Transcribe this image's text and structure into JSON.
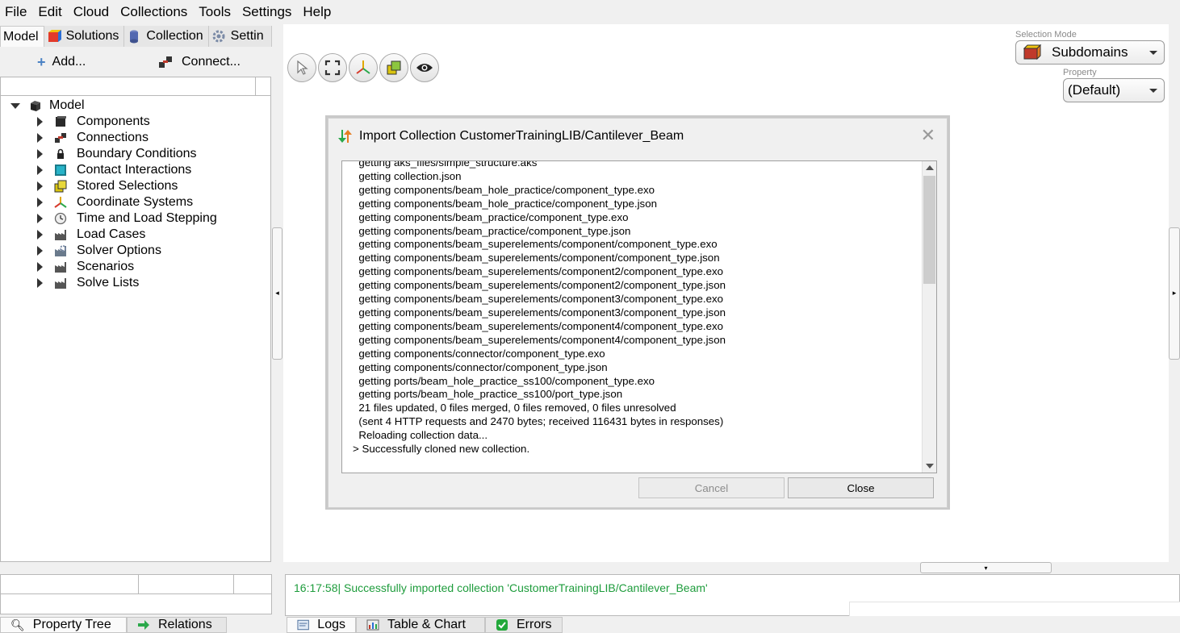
{
  "menu": [
    "File",
    "Edit",
    "Cloud",
    "Collections",
    "Tools",
    "Settings",
    "Help"
  ],
  "left_tabs": [
    "Model",
    "Solutions",
    "Collection",
    "Settings"
  ],
  "left_tabs_visible": [
    "Model",
    "Solutions",
    "Collection",
    "Settin"
  ],
  "toolbar": {
    "add_label": "Add...",
    "connect_label": "Connect..."
  },
  "tree": {
    "root": "Model",
    "children": [
      "Components",
      "Connections",
      "Boundary Conditions",
      "Contact Interactions",
      "Stored Selections",
      "Coordinate Systems",
      "Time and Load Stepping",
      "Load Cases",
      "Solver Options",
      "Scenarios",
      "Solve Lists"
    ]
  },
  "selection_mode": {
    "label": "Selection Mode",
    "value": "Subdomains"
  },
  "property": {
    "label": "Property",
    "value": "(Default)"
  },
  "dialog": {
    "title": "Import Collection CustomerTrainingLIB/Cantilever_Beam",
    "log_lines": [
      "  getting aks_files/simple_structure.aks",
      "  getting collection.json",
      "  getting components/beam_hole_practice/component_type.exo",
      "  getting components/beam_hole_practice/component_type.json",
      "  getting components/beam_practice/component_type.exo",
      "  getting components/beam_practice/component_type.json",
      "  getting components/beam_superelements/component/component_type.exo",
      "  getting components/beam_superelements/component/component_type.json",
      "  getting components/beam_superelements/component2/component_type.exo",
      "  getting components/beam_superelements/component2/component_type.json",
      "  getting components/beam_superelements/component3/component_type.exo",
      "  getting components/beam_superelements/component3/component_type.json",
      "  getting components/beam_superelements/component4/component_type.exo",
      "  getting components/beam_superelements/component4/component_type.json",
      "  getting components/connector/component_type.exo",
      "  getting components/connector/component_type.json",
      "  getting ports/beam_hole_practice_ss100/component_type.exo",
      "  getting ports/beam_hole_practice_ss100/port_type.json",
      "  21 files updated, 0 files merged, 0 files removed, 0 files unresolved",
      "  (sent 4 HTTP requests and 2470 bytes; received 116431 bytes in responses)",
      "  Reloading collection data...",
      "> Successfully cloned new collection."
    ],
    "cancel_label": "Cancel",
    "close_label": "Close"
  },
  "bottom_left_tabs": [
    "Property Tree",
    "Relations"
  ],
  "bottom_tabs": [
    "Logs",
    "Table & Chart",
    "Errors"
  ],
  "log_message": "16:17:58| Successfully imported collection 'CustomerTrainingLIB/Cantilever_Beam'",
  "colors": {
    "success_green": "#1e9c3c"
  }
}
